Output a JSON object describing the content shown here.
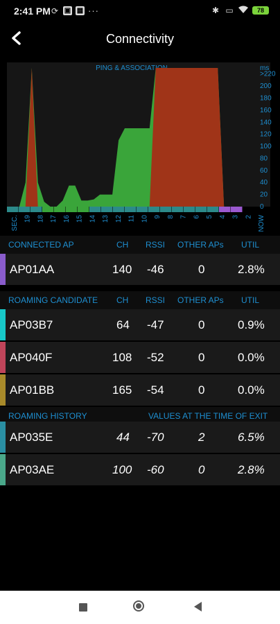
{
  "status_bar": {
    "time": "2:41 PM",
    "dots": "···",
    "battery": "78",
    "icons_left": [
      "sync-icon",
      "app-icon",
      "app-icon"
    ],
    "icons_right": [
      "bluetooth-icon",
      "box-icon",
      "wifi-icon",
      "battery-icon"
    ]
  },
  "header": {
    "title": "Connectivity",
    "back_icon": "back-arrow-icon"
  },
  "chart_data": {
    "type": "area",
    "title": "PING & ASSOCIATION",
    "ylabel": "ms",
    "y_ticks": [
      ">220",
      "200",
      "180",
      "160",
      "140",
      "120",
      "100",
      "80",
      "60",
      "40",
      "20",
      "0"
    ],
    "x_ticks": [
      "SEC.",
      "19",
      "18",
      "17",
      "16",
      "15",
      "14",
      "13",
      "12",
      "11",
      "10",
      "9",
      "8",
      "7",
      "6",
      "5",
      "4",
      "3",
      "2",
      "NOW"
    ],
    "ylim": [
      0,
      220
    ],
    "series": [
      {
        "values": [
          0,
          0,
          0,
          40,
          230,
          40,
          8,
          0,
          0,
          10,
          35,
          35,
          10,
          10,
          12,
          20,
          20,
          20,
          110,
          130,
          130,
          130,
          130,
          130,
          230,
          230,
          230,
          230,
          230,
          230,
          230,
          230,
          230,
          230,
          230,
          0,
          0,
          0,
          0
        ],
        "color": "#3aa53a"
      },
      {
        "values": [
          0,
          0,
          0,
          0,
          230,
          0,
          0,
          0,
          0,
          0,
          0,
          0,
          0,
          0,
          0,
          0,
          0,
          0,
          0,
          0,
          0,
          0,
          0,
          0,
          230,
          230,
          230,
          230,
          230,
          230,
          230,
          230,
          230,
          230,
          230,
          0,
          0,
          0,
          0
        ],
        "color": "#a03418"
      }
    ],
    "strip_colors": [
      "#2c8a8a",
      "#2c8a8a",
      "#2c8a8a",
      "#3aa53a",
      "#3aa53a",
      "#3aa53a",
      "#3aa53a",
      "#2c8a8a",
      "#2c8a8a",
      "#2c8a8a",
      "#2c8a8a",
      "#2c8a8a",
      "#2c8a8a",
      "#2c8a8a",
      "#2c8a8a",
      "#2c8a8a",
      "#2c8a8a",
      "#2c8a8a",
      "#9b59d0",
      "#9b59d0"
    ],
    "colors": {
      "green": "#3aa53a",
      "red": "#a03418",
      "axis": "#1e8fd1"
    }
  },
  "connected": {
    "headers": [
      "CONNECTED AP",
      "CH",
      "RSSI",
      "OTHER APs",
      "UTIL"
    ],
    "rows": [
      {
        "name": "AP01AA",
        "ch": "140",
        "rssi": "-46",
        "other": "0",
        "util": "2.8%",
        "color": "#8a5ccc"
      }
    ]
  },
  "roaming": {
    "headers": [
      "ROAMING CANDIDATE",
      "CH",
      "RSSI",
      "OTHER APs",
      "UTIL"
    ],
    "rows": [
      {
        "name": "AP03B7",
        "ch": "64",
        "rssi": "-47",
        "other": "0",
        "util": "0.9%",
        "color": "#18c9c9"
      },
      {
        "name": "AP040F",
        "ch": "108",
        "rssi": "-52",
        "other": "0",
        "util": "0.0%",
        "color": "#c0455a"
      },
      {
        "name": "AP01BB",
        "ch": "165",
        "rssi": "-54",
        "other": "0",
        "util": "0.0%",
        "color": "#a88a2a"
      }
    ]
  },
  "history": {
    "header_left": "ROAMING HISTORY",
    "header_right": "VALUES AT THE TIME OF EXIT",
    "rows": [
      {
        "name": "AP035E",
        "ch": "44",
        "rssi": "-70",
        "other": "2",
        "util": "6.5%",
        "color": "#2a8fa3"
      },
      {
        "name": "AP03AE",
        "ch": "100",
        "rssi": "-60",
        "other": "0",
        "util": "2.8%",
        "color": "#4aa88a"
      }
    ]
  },
  "navbar": {
    "icons": [
      "recents-icon",
      "home-icon",
      "back-icon"
    ]
  }
}
